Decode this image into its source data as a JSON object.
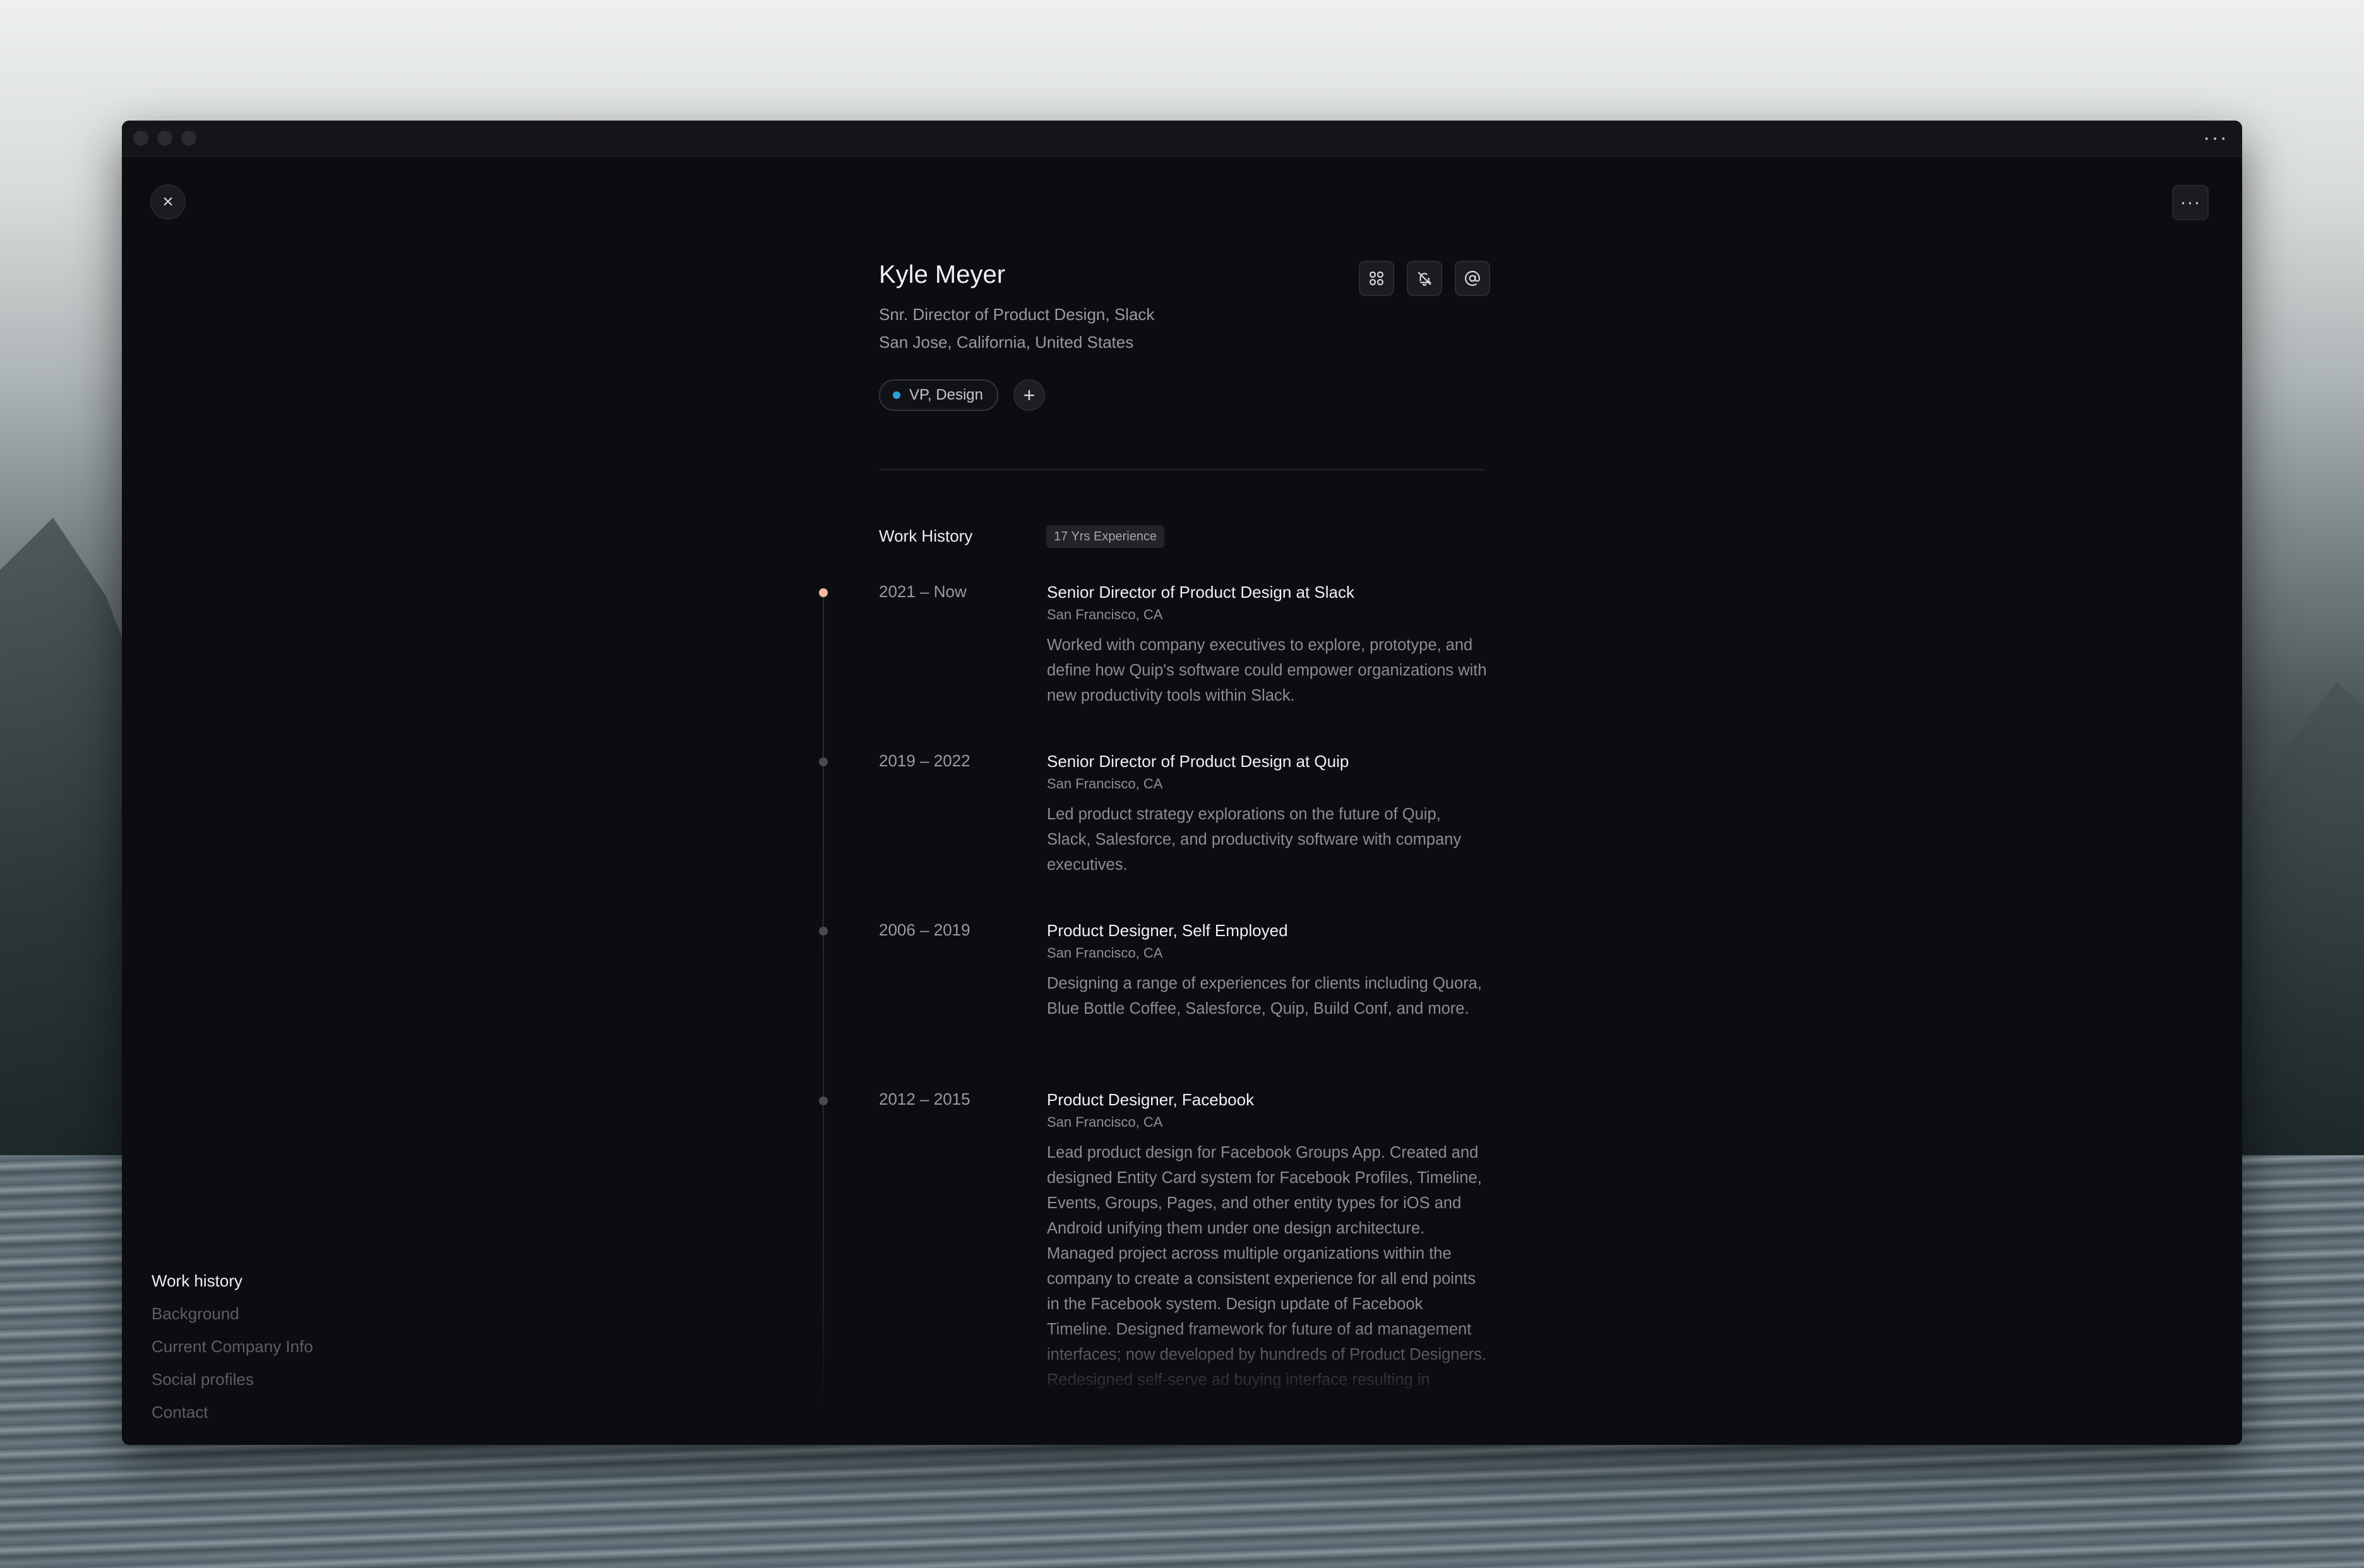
{
  "window": {
    "title_more": "···"
  },
  "toolbar": {
    "close_icon": "×",
    "more_icon": "···"
  },
  "profile": {
    "name": "Kyle Meyer",
    "role": "Snr. Director of Product Design, Slack",
    "location": "San Jose, California, United States",
    "tags": [
      {
        "label": "VP, Design",
        "dot_color": "#2aa4d6"
      }
    ],
    "add_tag_icon": "+",
    "actions": [
      {
        "name": "command-icon",
        "glyph": "⌘"
      },
      {
        "name": "bell-off-icon",
        "glyph": "🔕"
      },
      {
        "name": "at-sign-icon",
        "glyph": "@"
      }
    ]
  },
  "work_history": {
    "title": "Work History",
    "experience_badge": "17 Yrs Experience",
    "entries": [
      {
        "years": "2021 – Now",
        "title": "Senior Director of Product Design at Slack",
        "place": "San Francisco, CA",
        "description": "Worked with company executives to explore, prototype, and define how Quip's software could empower organizations with new productivity tools within Slack.",
        "current": true
      },
      {
        "years": "2019 – 2022",
        "title": "Senior Director of Product Design at Quip",
        "place": "San Francisco, CA",
        "description": "Led product strategy explorations on the future of Quip, Slack, Salesforce, and productivity software with company executives.",
        "current": false
      },
      {
        "years": "2006 – 2019",
        "title": "Product Designer, Self Employed",
        "place": "San Francisco, CA",
        "description": "Designing a range of experiences for clients including Quora, Blue Bottle Coffee, Salesforce, Quip, Build Conf, and more.",
        "current": false
      },
      {
        "years": "2012 – 2015",
        "title": "Product Designer, Facebook",
        "place": "San Francisco, CA",
        "description": "Lead product design for Facebook Groups App. Created and designed Entity Card system for Facebook Profiles, Timeline, Events, Groups, Pages, and other entity types for iOS and Android unifying them under one design architecture. Managed project across multiple organizations within the company to create a consistent experience for all end points in the Facebook system. Design update of Facebook Timeline. Designed framework for future of ad management interfaces; now developed by hundreds of Product Designers. Redesigned self-serve ad buying interface resulting in",
        "current": false
      }
    ]
  },
  "side_nav": {
    "items": [
      {
        "label": "Work history",
        "active": true
      },
      {
        "label": "Background",
        "active": false
      },
      {
        "label": "Current Company Info",
        "active": false
      },
      {
        "label": "Social profiles",
        "active": false
      },
      {
        "label": "Contact",
        "active": false
      }
    ]
  },
  "colors": {
    "window_bg": "#0c0d10",
    "accent_current_dot": "#f2b9a0",
    "tag_dot": "#2aa4d6"
  }
}
